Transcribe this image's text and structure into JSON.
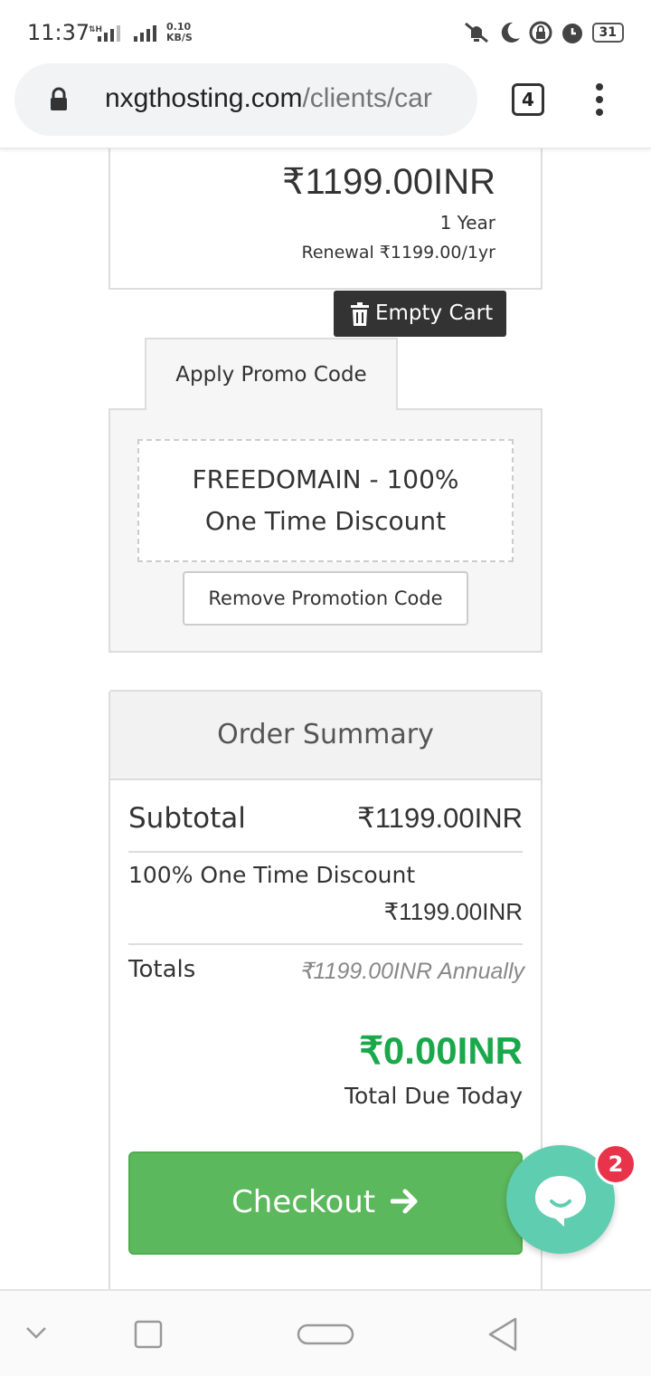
{
  "status_bar": {
    "time": "11:37",
    "net_type": "H",
    "speed_value": "0.10",
    "speed_unit": "KB/S",
    "battery": "31"
  },
  "browser": {
    "url_host": "nxgthosting.com",
    "url_path": "/clients/car",
    "tab_count": "4"
  },
  "product": {
    "price": "₹1199.00INR",
    "period": "1 Year",
    "renewal": "Renewal ₹1199.00/1yr"
  },
  "cart": {
    "empty_label": "Empty Cart"
  },
  "promo": {
    "tab_label": "Apply Promo Code",
    "code_line1": "FREEDOMAIN - 100%",
    "code_line2": "One Time Discount",
    "remove_label": "Remove Promotion Code"
  },
  "summary": {
    "title": "Order Summary",
    "subtotal_label": "Subtotal",
    "subtotal_value": "₹1199.00INR",
    "discount_label": "100% One Time Discount",
    "discount_value": "₹1199.00INR",
    "totals_label": "Totals",
    "totals_value": "₹1199.00INR Annually",
    "due_amount": "₹0.00INR",
    "due_label": "Total Due Today",
    "checkout_label": "Checkout"
  },
  "chat": {
    "badge_count": "2"
  },
  "colors": {
    "checkout_green": "#5cb85c",
    "due_green": "#19a84a",
    "chat_teal": "#5fcdb0",
    "badge_red": "#e8334a",
    "empty_cart_dark": "#333333"
  }
}
